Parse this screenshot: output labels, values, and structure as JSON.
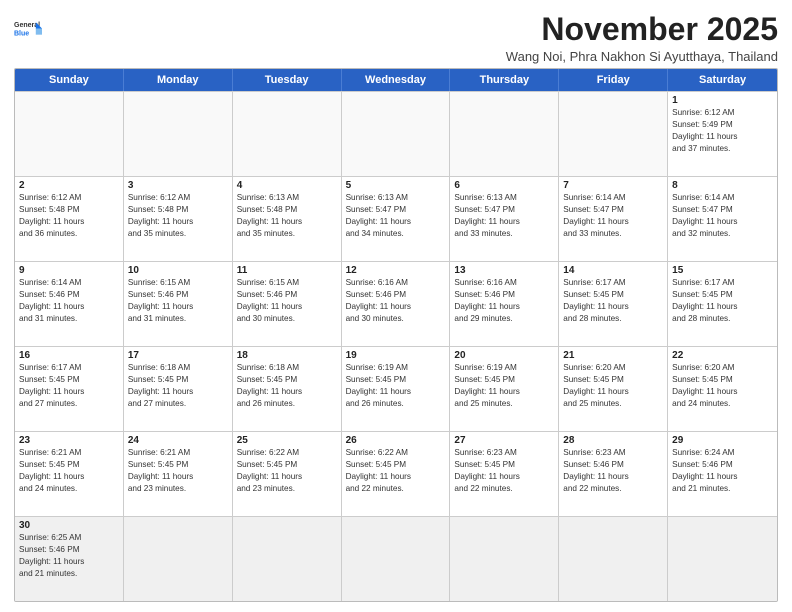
{
  "header": {
    "logo_general": "General",
    "logo_blue": "Blue",
    "month_title": "November 2025",
    "location": "Wang Noi, Phra Nakhon Si Ayutthaya, Thailand"
  },
  "day_headers": [
    "Sunday",
    "Monday",
    "Tuesday",
    "Wednesday",
    "Thursday",
    "Friday",
    "Saturday"
  ],
  "weeks": [
    [
      {
        "day": "",
        "empty": true,
        "info": ""
      },
      {
        "day": "",
        "empty": true,
        "info": ""
      },
      {
        "day": "",
        "empty": true,
        "info": ""
      },
      {
        "day": "",
        "empty": true,
        "info": ""
      },
      {
        "day": "",
        "empty": true,
        "info": ""
      },
      {
        "day": "",
        "empty": true,
        "info": ""
      },
      {
        "day": "1",
        "empty": false,
        "info": "Sunrise: 6:12 AM\nSunset: 5:49 PM\nDaylight: 11 hours\nand 37 minutes."
      }
    ],
    [
      {
        "day": "2",
        "empty": false,
        "info": "Sunrise: 6:12 AM\nSunset: 5:48 PM\nDaylight: 11 hours\nand 36 minutes."
      },
      {
        "day": "3",
        "empty": false,
        "info": "Sunrise: 6:12 AM\nSunset: 5:48 PM\nDaylight: 11 hours\nand 35 minutes."
      },
      {
        "day": "4",
        "empty": false,
        "info": "Sunrise: 6:13 AM\nSunset: 5:48 PM\nDaylight: 11 hours\nand 35 minutes."
      },
      {
        "day": "5",
        "empty": false,
        "info": "Sunrise: 6:13 AM\nSunset: 5:47 PM\nDaylight: 11 hours\nand 34 minutes."
      },
      {
        "day": "6",
        "empty": false,
        "info": "Sunrise: 6:13 AM\nSunset: 5:47 PM\nDaylight: 11 hours\nand 33 minutes."
      },
      {
        "day": "7",
        "empty": false,
        "info": "Sunrise: 6:14 AM\nSunset: 5:47 PM\nDaylight: 11 hours\nand 33 minutes."
      },
      {
        "day": "8",
        "empty": false,
        "info": "Sunrise: 6:14 AM\nSunset: 5:47 PM\nDaylight: 11 hours\nand 32 minutes."
      }
    ],
    [
      {
        "day": "9",
        "empty": false,
        "info": "Sunrise: 6:14 AM\nSunset: 5:46 PM\nDaylight: 11 hours\nand 31 minutes."
      },
      {
        "day": "10",
        "empty": false,
        "info": "Sunrise: 6:15 AM\nSunset: 5:46 PM\nDaylight: 11 hours\nand 31 minutes."
      },
      {
        "day": "11",
        "empty": false,
        "info": "Sunrise: 6:15 AM\nSunset: 5:46 PM\nDaylight: 11 hours\nand 30 minutes."
      },
      {
        "day": "12",
        "empty": false,
        "info": "Sunrise: 6:16 AM\nSunset: 5:46 PM\nDaylight: 11 hours\nand 30 minutes."
      },
      {
        "day": "13",
        "empty": false,
        "info": "Sunrise: 6:16 AM\nSunset: 5:46 PM\nDaylight: 11 hours\nand 29 minutes."
      },
      {
        "day": "14",
        "empty": false,
        "info": "Sunrise: 6:17 AM\nSunset: 5:45 PM\nDaylight: 11 hours\nand 28 minutes."
      },
      {
        "day": "15",
        "empty": false,
        "info": "Sunrise: 6:17 AM\nSunset: 5:45 PM\nDaylight: 11 hours\nand 28 minutes."
      }
    ],
    [
      {
        "day": "16",
        "empty": false,
        "info": "Sunrise: 6:17 AM\nSunset: 5:45 PM\nDaylight: 11 hours\nand 27 minutes."
      },
      {
        "day": "17",
        "empty": false,
        "info": "Sunrise: 6:18 AM\nSunset: 5:45 PM\nDaylight: 11 hours\nand 27 minutes."
      },
      {
        "day": "18",
        "empty": false,
        "info": "Sunrise: 6:18 AM\nSunset: 5:45 PM\nDaylight: 11 hours\nand 26 minutes."
      },
      {
        "day": "19",
        "empty": false,
        "info": "Sunrise: 6:19 AM\nSunset: 5:45 PM\nDaylight: 11 hours\nand 26 minutes."
      },
      {
        "day": "20",
        "empty": false,
        "info": "Sunrise: 6:19 AM\nSunset: 5:45 PM\nDaylight: 11 hours\nand 25 minutes."
      },
      {
        "day": "21",
        "empty": false,
        "info": "Sunrise: 6:20 AM\nSunset: 5:45 PM\nDaylight: 11 hours\nand 25 minutes."
      },
      {
        "day": "22",
        "empty": false,
        "info": "Sunrise: 6:20 AM\nSunset: 5:45 PM\nDaylight: 11 hours\nand 24 minutes."
      }
    ],
    [
      {
        "day": "23",
        "empty": false,
        "info": "Sunrise: 6:21 AM\nSunset: 5:45 PM\nDaylight: 11 hours\nand 24 minutes."
      },
      {
        "day": "24",
        "empty": false,
        "info": "Sunrise: 6:21 AM\nSunset: 5:45 PM\nDaylight: 11 hours\nand 23 minutes."
      },
      {
        "day": "25",
        "empty": false,
        "info": "Sunrise: 6:22 AM\nSunset: 5:45 PM\nDaylight: 11 hours\nand 23 minutes."
      },
      {
        "day": "26",
        "empty": false,
        "info": "Sunrise: 6:22 AM\nSunset: 5:45 PM\nDaylight: 11 hours\nand 22 minutes."
      },
      {
        "day": "27",
        "empty": false,
        "info": "Sunrise: 6:23 AM\nSunset: 5:45 PM\nDaylight: 11 hours\nand 22 minutes."
      },
      {
        "day": "28",
        "empty": false,
        "info": "Sunrise: 6:23 AM\nSunset: 5:46 PM\nDaylight: 11 hours\nand 22 minutes."
      },
      {
        "day": "29",
        "empty": false,
        "info": "Sunrise: 6:24 AM\nSunset: 5:46 PM\nDaylight: 11 hours\nand 21 minutes."
      }
    ],
    [
      {
        "day": "30",
        "empty": false,
        "last_row": true,
        "info": "Sunrise: 6:25 AM\nSunset: 5:46 PM\nDaylight: 11 hours\nand 21 minutes."
      },
      {
        "day": "",
        "empty": true,
        "last_row": true,
        "info": ""
      },
      {
        "day": "",
        "empty": true,
        "last_row": true,
        "info": ""
      },
      {
        "day": "",
        "empty": true,
        "last_row": true,
        "info": ""
      },
      {
        "day": "",
        "empty": true,
        "last_row": true,
        "info": ""
      },
      {
        "day": "",
        "empty": true,
        "last_row": true,
        "info": ""
      },
      {
        "day": "",
        "empty": true,
        "last_row": true,
        "info": ""
      }
    ]
  ]
}
